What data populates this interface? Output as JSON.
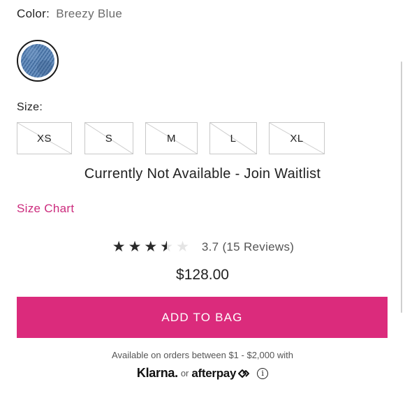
{
  "color": {
    "label": "Color:",
    "value": "Breezy Blue",
    "swatch_color": "#4f78a8"
  },
  "size": {
    "label": "Size:",
    "options": [
      "XS",
      "S",
      "M",
      "L",
      "XL"
    ],
    "unavailable_message": "Currently Not Available - Join Waitlist",
    "size_chart_label": "Size Chart"
  },
  "rating": {
    "value": 3.7,
    "text": "3.7 (15 Reviews)",
    "max": 5
  },
  "price": "$128.00",
  "add_to_bag_label": "ADD TO BAG",
  "payment": {
    "note": "Available on orders between $1 - $2,000 with",
    "klarna": "Klarna.",
    "or": "or",
    "afterpay": "afterpay"
  },
  "colors": {
    "accent": "#db2b7c",
    "size_chart_link": "#cc2b7d"
  }
}
